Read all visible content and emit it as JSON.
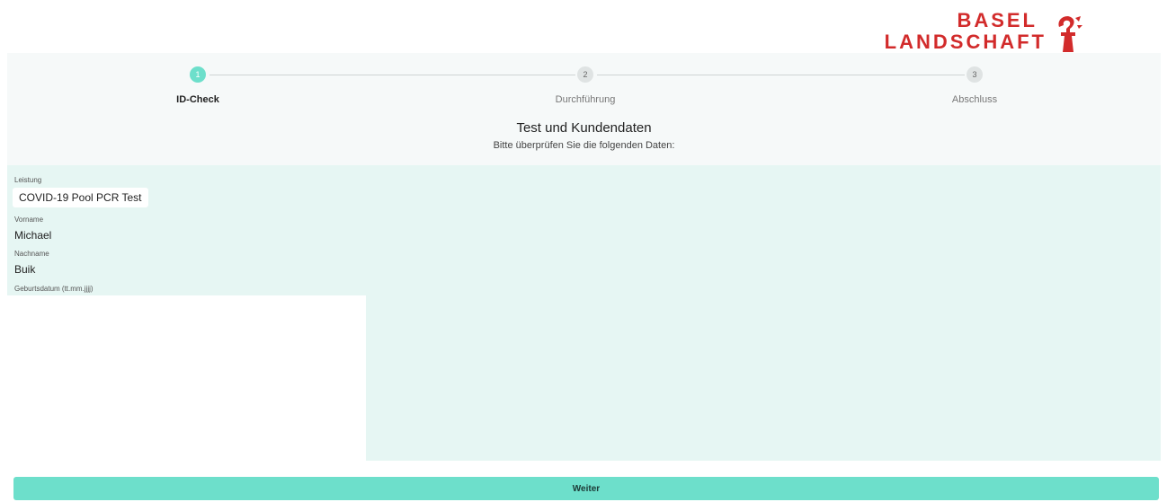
{
  "logo": {
    "line1": "BASEL",
    "line2": "LANDSCHAFT"
  },
  "steps": [
    {
      "number": "1",
      "label": "ID-Check",
      "active": true
    },
    {
      "number": "2",
      "label": "Durchführung",
      "active": false
    },
    {
      "number": "3",
      "label": "Abschluss",
      "active": false
    }
  ],
  "section": {
    "title": "Test und Kundendaten",
    "subtitle": "Bitte überprüfen Sie die folgenden Daten:"
  },
  "fields": {
    "leistung": {
      "label": "Leistung",
      "value": "COVID-19 Pool PCR Test"
    },
    "vorname": {
      "label": "Vorname",
      "value": "Michael"
    },
    "nachname": {
      "label": "Nachname",
      "value": "Buik"
    },
    "geburtsdatum": {
      "label": "Geburtsdatum (tt.mm.jjjj)",
      "value": ""
    }
  },
  "actions": {
    "weiter_label": "Weiter"
  },
  "colors": {
    "accent": "#6ddfcb",
    "brand_red": "#d22b2b",
    "form_bg": "#e6f6f3"
  }
}
